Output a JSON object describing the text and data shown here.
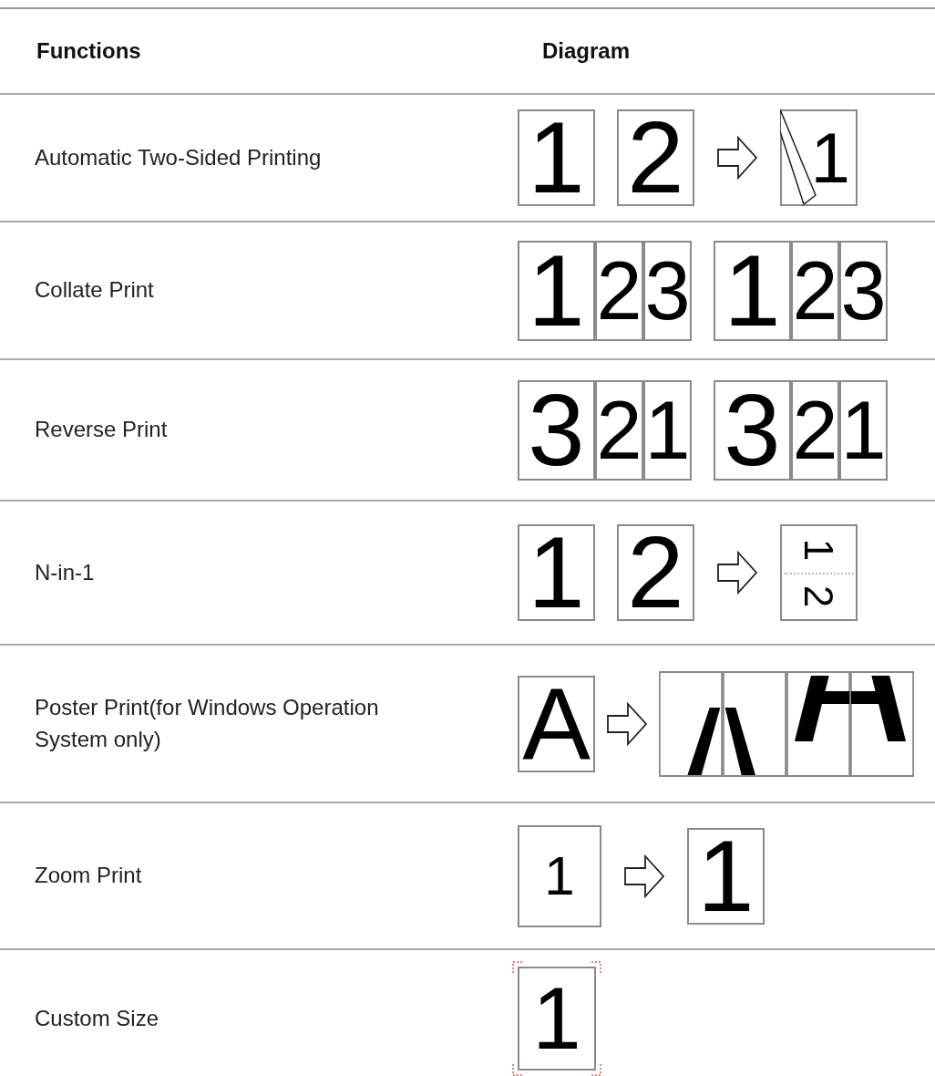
{
  "table": {
    "columns": [
      "Functions",
      "Diagram"
    ],
    "rows": [
      {
        "function": "Automatic Two-Sided Printing",
        "diagram": [
          {
            "kind": "page",
            "label": "1"
          },
          {
            "kind": "page",
            "label": "2"
          },
          {
            "kind": "arrow"
          },
          {
            "kind": "flipped",
            "label": "1"
          }
        ]
      },
      {
        "function": "Collate Print",
        "diagram": [
          {
            "kind": "stack",
            "labels": [
              "1",
              "2",
              "3"
            ]
          },
          {
            "kind": "stack",
            "labels": [
              "1",
              "2",
              "3"
            ]
          }
        ]
      },
      {
        "function": "Reverse Print",
        "diagram": [
          {
            "kind": "stack",
            "labels": [
              "3",
              "2",
              "1"
            ]
          },
          {
            "kind": "stack",
            "labels": [
              "3",
              "2",
              "1"
            ]
          }
        ]
      },
      {
        "function": "N-in-1",
        "diagram": [
          {
            "kind": "page",
            "label": "1"
          },
          {
            "kind": "page",
            "label": "2"
          },
          {
            "kind": "arrow"
          },
          {
            "kind": "combined",
            "labels": [
              "1",
              "2"
            ]
          }
        ]
      },
      {
        "function": "Poster Print(for Windows Operation System only)",
        "diagram": [
          {
            "kind": "page",
            "label": "A"
          },
          {
            "kind": "arrow"
          },
          {
            "kind": "tiles"
          }
        ]
      },
      {
        "function": "Zoom Print",
        "diagram": [
          {
            "kind": "small-page",
            "label": "1"
          },
          {
            "kind": "arrow"
          },
          {
            "kind": "page",
            "label": "1"
          }
        ]
      },
      {
        "function": "Custom Size",
        "diagram": [
          {
            "kind": "cropped",
            "label": "1"
          }
        ]
      }
    ]
  }
}
